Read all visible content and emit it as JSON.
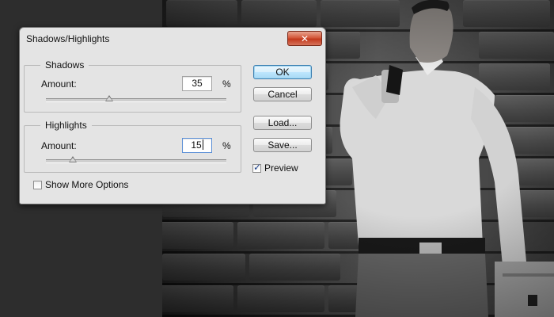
{
  "dialog": {
    "title": "Shadows/Highlights",
    "close_icon": "close-icon"
  },
  "shadows": {
    "legend": "Shadows",
    "amount_label": "Amount:",
    "value": "35",
    "unit": "%",
    "slider_fraction": 0.35
  },
  "highlights": {
    "legend": "Highlights",
    "amount_label": "Amount:",
    "value": "15",
    "unit": "%",
    "slider_fraction": 0.15
  },
  "buttons": {
    "ok": "OK",
    "cancel": "Cancel",
    "load": "Load...",
    "save": "Save..."
  },
  "options": {
    "preview_label": "Preview",
    "preview_checked": true,
    "show_more_label": "Show More Options",
    "show_more_checked": false
  },
  "colors": {
    "default_button_border": "#3c7fb1",
    "close_button": "#c23a1e"
  }
}
